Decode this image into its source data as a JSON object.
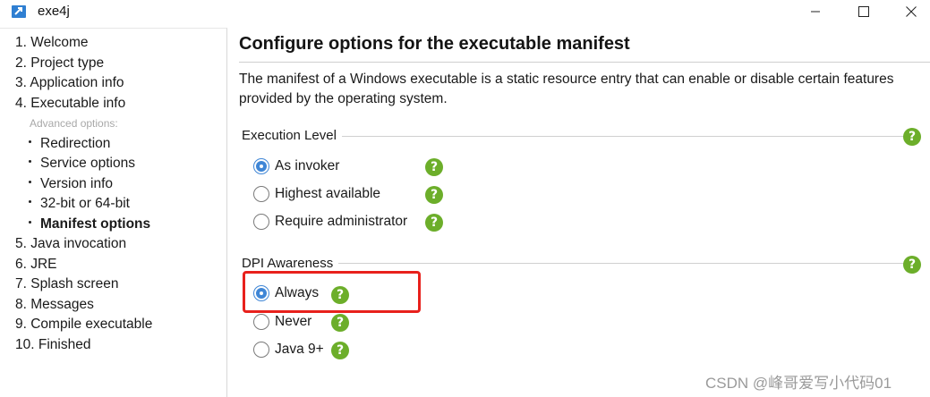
{
  "window": {
    "title": "exe4j",
    "icon": "exe4j-app-icon",
    "controls": [
      "minimize-icon",
      "maximize-icon",
      "close-icon"
    ]
  },
  "nav": {
    "items": [
      {
        "label": "1. Welcome"
      },
      {
        "label": "2. Project type"
      },
      {
        "label": "3. Application info"
      },
      {
        "label": "4. Executable info"
      }
    ],
    "advanced_label": "Advanced options:",
    "advanced_items": [
      {
        "label": "Redirection",
        "active": false
      },
      {
        "label": "Service options",
        "active": false
      },
      {
        "label": "Version info",
        "active": false
      },
      {
        "label": "32-bit or 64-bit",
        "active": false
      },
      {
        "label": "Manifest options",
        "active": true
      }
    ],
    "items_after": [
      {
        "label": "5. Java invocation"
      },
      {
        "label": "6. JRE"
      },
      {
        "label": "7. Splash screen"
      },
      {
        "label": "8. Messages"
      },
      {
        "label": "9. Compile executable"
      },
      {
        "label": "10. Finished"
      }
    ]
  },
  "main": {
    "heading": "Configure options for the executable manifest",
    "description": "The manifest of a Windows executable is a static resource entry that can enable or disable certain features provided by the operating system.",
    "execution_level": {
      "label": "Execution Level",
      "options": [
        {
          "label": "As invoker",
          "checked": true
        },
        {
          "label": "Highest available",
          "checked": false
        },
        {
          "label": "Require administrator",
          "checked": false
        }
      ]
    },
    "dpi_awareness": {
      "label": "DPI Awareness",
      "options": [
        {
          "label": "Always",
          "checked": true
        },
        {
          "label": "Never",
          "checked": false
        },
        {
          "label": "Java 9+",
          "checked": false
        }
      ]
    },
    "help_glyph": "?"
  },
  "colors": {
    "accent": "#3f86d6",
    "help_green": "#6cae2a",
    "highlight_red": "#e8211c"
  },
  "watermark": "CSDN @峰哥爱写小代码01"
}
